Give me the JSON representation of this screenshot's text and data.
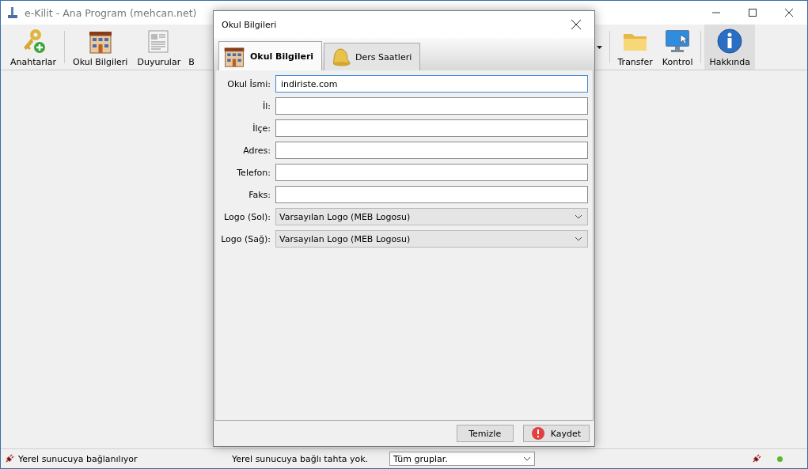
{
  "window": {
    "title": "e-Kilit - Ana Program (mehcan.net)"
  },
  "toolbar": {
    "left": [
      {
        "label": "Anahtarlar",
        "kind": "keys"
      },
      {
        "label": "Okul Bilgileri",
        "kind": "school"
      },
      {
        "label": "Duyurular",
        "kind": "news"
      },
      {
        "label": "B",
        "kind": "partial"
      }
    ],
    "right": [
      {
        "label": "Transfer",
        "kind": "folder"
      },
      {
        "label": "Kontrol",
        "kind": "monitor"
      },
      {
        "label": "Hakkında",
        "kind": "info"
      }
    ]
  },
  "dialog": {
    "title": "Okul Bilgileri",
    "tabs": [
      {
        "label": "Okul Bilgileri",
        "kind": "school",
        "selected": true
      },
      {
        "label": "Ders Saatleri",
        "kind": "bell",
        "selected": false
      }
    ],
    "fields": [
      {
        "label": "Okul İsmi:",
        "kind": "text",
        "value": "indiriste.com",
        "focused": true
      },
      {
        "label": "İl:",
        "kind": "text",
        "focused": false
      },
      {
        "label": "İlçe:",
        "kind": "text",
        "focused": false
      },
      {
        "label": "Adres:",
        "kind": "text",
        "focused": false
      },
      {
        "label": "Telefon:",
        "kind": "text",
        "focused": false
      },
      {
        "label": "Faks:",
        "kind": "text",
        "focused": false
      },
      {
        "label": "Logo (Sol):",
        "kind": "select",
        "value": "Varsayılan Logo (MEB Logosu)"
      },
      {
        "label": "Logo (Sağ):",
        "kind": "select",
        "value": "Varsayılan Logo (MEB Logosu)"
      }
    ],
    "buttons": [
      {
        "label": "Temizle",
        "kind": "plain"
      },
      {
        "label": "Kaydet",
        "kind": "save"
      }
    ]
  },
  "status_bar": {
    "connection": "Yerel sunucuya bağlanılıyor",
    "boards": "Yerel sunucuya bağlı tahta yok.",
    "group_filter": "Tüm gruplar."
  }
}
